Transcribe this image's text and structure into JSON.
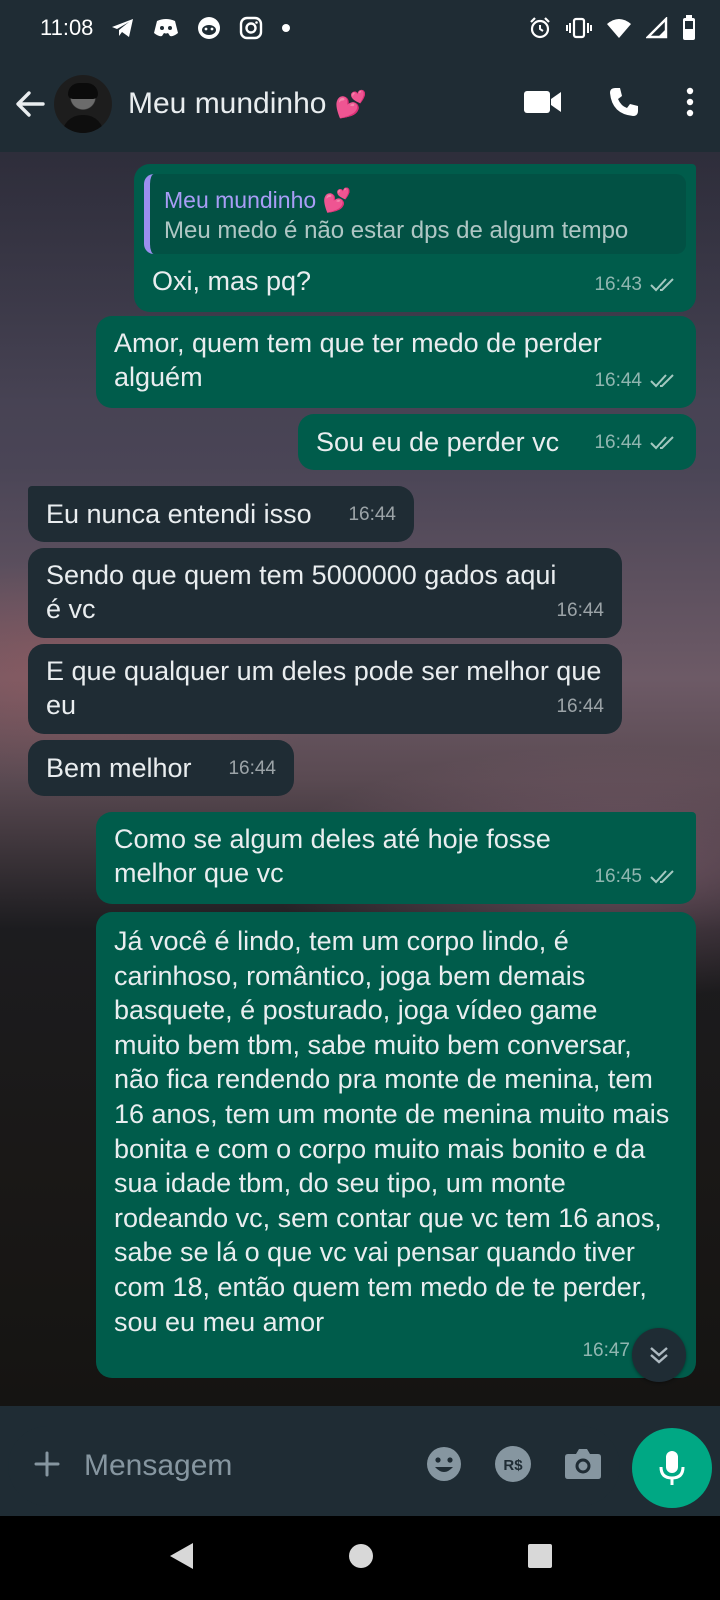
{
  "status_bar": {
    "time": "11:08",
    "notification_icons": [
      "telegram-icon",
      "discord-icon",
      "reddit-icon",
      "instagram-icon",
      "dot-icon"
    ],
    "system_icons": [
      "alarm-icon",
      "vibrate-icon",
      "wifi-icon",
      "signal-icon",
      "battery-icon"
    ]
  },
  "header": {
    "contact_name": "Meu mundinho",
    "emoji": "💕",
    "actions": [
      "video-call-icon",
      "voice-call-icon",
      "more-options-icon"
    ]
  },
  "messages": [
    {
      "direction": "outgoing",
      "quote": {
        "author": "Meu mundinho 💕",
        "text": "Meu medo é não estar dps de algum tempo"
      },
      "text": "Oxi, mas pq?",
      "time": "16:43",
      "read": true
    },
    {
      "direction": "outgoing",
      "text": "Amor, quem tem que ter medo de perder alguém",
      "time": "16:44",
      "read": true
    },
    {
      "direction": "outgoing",
      "text": "Sou eu de perder vc",
      "time": "16:44",
      "read": true
    },
    {
      "direction": "incoming",
      "text": "Eu nunca entendi isso",
      "time": "16:44"
    },
    {
      "direction": "incoming",
      "text": "Sendo que quem tem 5000000 gados aqui é vc",
      "time": "16:44"
    },
    {
      "direction": "incoming",
      "text": "E que qualquer um deles pode ser melhor que eu",
      "time": "16:44"
    },
    {
      "direction": "incoming",
      "text": "Bem melhor",
      "time": "16:44"
    },
    {
      "direction": "outgoing",
      "text": "Como se algum deles até hoje fosse melhor que vc",
      "time": "16:45",
      "read": true
    },
    {
      "direction": "outgoing",
      "text": "Já você é lindo, tem um corpo lindo, é carinhoso, romântico, joga bem demais basquete, é posturado, joga vídeo game muito bem tbm, sabe muito bem conversar, não fica rendendo pra monte de menina, tem 16 anos, tem um monte de menina muito mais bonita e com o corpo muito mais bonito e da sua idade tbm, do seu tipo, um monte rodeando vc, sem contar que vc tem 16 anos, sabe se lá o que vc vai pensar quando tiver com 18, então quem tem medo de te perder, sou eu meu amor",
      "time": "16:47"
    }
  ],
  "composer": {
    "placeholder": "Mensagem",
    "tools": [
      "emoji-icon",
      "payment-icon",
      "camera-icon"
    ]
  },
  "colors": {
    "outgoing_bubble": "#005c4b",
    "incoming_bubble": "#1f2c34",
    "header_bg": "#1f2c34",
    "accent": "#00a884",
    "read_ticks": "#a4c8c0"
  }
}
